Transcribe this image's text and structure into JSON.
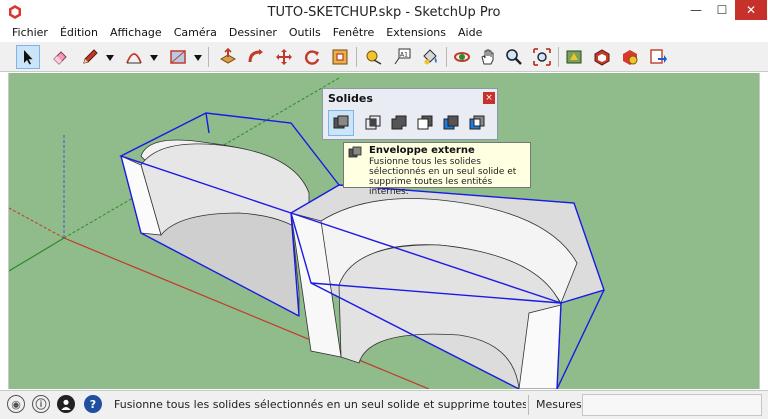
{
  "window": {
    "title": "TUTO-SKETCHUP.skp - SketchUp Pro",
    "minimize": "—",
    "maximize": "☐",
    "close": "✕"
  },
  "menu": {
    "items": [
      "Fichier",
      "Édition",
      "Affichage",
      "Caméra",
      "Dessiner",
      "Outils",
      "Fenêtre",
      "Extensions",
      "Aide"
    ]
  },
  "toolbar": {
    "tools": [
      "select-icon",
      "eraser-icon",
      "pencil-icon",
      "arc-icon",
      "rectangle-icon",
      "push-pull-icon",
      "follow-me-icon",
      "move-icon",
      "rotate-icon",
      "offset-icon",
      "tape-measure-icon",
      "text-icon",
      "paint-bucket-icon",
      "orbit-icon",
      "pan-icon",
      "zoom-icon",
      "zoom-extents-icon",
      "warehouse-icon",
      "extension-warehouse-icon",
      "components-icon",
      "share-model-icon"
    ],
    "text_tool_label": "A1"
  },
  "solides_panel": {
    "title": "Solides",
    "close": "×",
    "tools": [
      "outer-shell-icon",
      "intersect-icon",
      "union-icon",
      "subtract-icon",
      "trim-icon",
      "split-icon"
    ]
  },
  "tooltip": {
    "title": "Enveloppe externe",
    "body": "Fusionne tous les solides sélectionnés en un seul solide et supprime toutes les entités internes."
  },
  "statusbar": {
    "icons": [
      "geo-location-icon",
      "credits-icon",
      "user-icon",
      "help-icon"
    ],
    "geo_symbol": "◉",
    "credits_symbol": "ⓘ",
    "help_symbol": "?",
    "text": "Fusionne tous les solides sélectionnés en un seul solide et supprime toutes les entité...",
    "measures_label": "Mesures",
    "measures_value": ""
  },
  "colors": {
    "viewport_bg": "#8fbc8a",
    "selection_blue": "#1a1ae6",
    "axis_red": "#c23a2a",
    "axis_green": "#2d8a2d",
    "axis_blue": "#3a5ad0",
    "close_red": "#c7312b",
    "tooltip_bg": "#ffffe1"
  }
}
